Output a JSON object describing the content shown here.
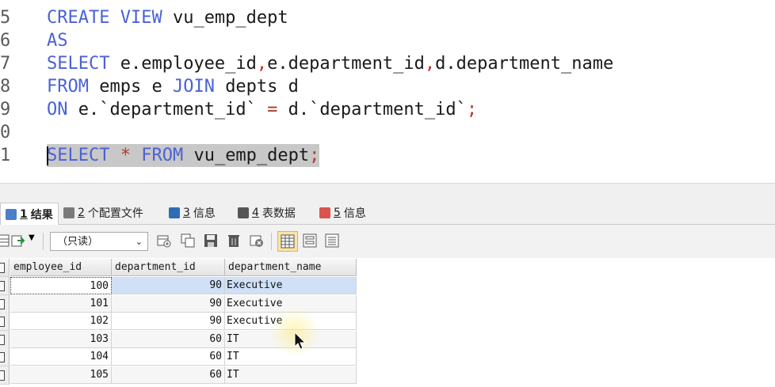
{
  "editor": {
    "lines": [
      {
        "num": "5",
        "tokens": [
          [
            "kw",
            "CREATE VIEW "
          ],
          [
            "txt",
            "vu_emp_dept"
          ]
        ]
      },
      {
        "num": "6",
        "tokens": [
          [
            "kw",
            "AS"
          ]
        ]
      },
      {
        "num": "7",
        "tokens": [
          [
            "kw",
            "SELECT "
          ],
          [
            "txt",
            "e.employee_id"
          ],
          [
            "op",
            ","
          ],
          [
            "txt",
            "e.department_id"
          ],
          [
            "op",
            ","
          ],
          [
            "txt",
            "d.department_name"
          ]
        ]
      },
      {
        "num": "8",
        "tokens": [
          [
            "kw",
            "FROM "
          ],
          [
            "txt",
            "emps e "
          ],
          [
            "kw",
            "JOIN "
          ],
          [
            "txt",
            "depts d"
          ]
        ]
      },
      {
        "num": "9",
        "tokens": [
          [
            "kw",
            "ON "
          ],
          [
            "txt",
            "e.`department_id` "
          ],
          [
            "op",
            "="
          ],
          [
            "txt",
            " d.`department_id`"
          ],
          [
            "op",
            ";"
          ]
        ]
      },
      {
        "num": "0",
        "tokens": []
      },
      {
        "num": "1",
        "tokens": [
          [
            "kw",
            "SELECT "
          ],
          [
            "op",
            "*"
          ],
          [
            "kw",
            " FROM "
          ],
          [
            "txt",
            "vu_emp_dept"
          ],
          [
            "op",
            ";"
          ]
        ],
        "highlighted": true
      }
    ]
  },
  "tabs": [
    {
      "num": "1",
      "label": "结果",
      "active": true,
      "icon": "table-icon",
      "color": "#4a7fc9"
    },
    {
      "num": "2",
      "label": "个配置文件",
      "icon": "profile-icon",
      "color": "#7a7a7a"
    },
    {
      "num": "3",
      "label": "信息",
      "icon": "info-icon",
      "color": "#2f6db3"
    },
    {
      "num": "4",
      "label": "表数据",
      "icon": "table-data-icon",
      "color": "#555555"
    },
    {
      "num": "5",
      "label": "信息",
      "icon": "history-icon",
      "color": "#d9534f"
    }
  ],
  "toolbar": {
    "mode_select": "（只读）"
  },
  "grid": {
    "columns": [
      "employee_id",
      "department_id",
      "department_name"
    ],
    "rows": [
      [
        "100",
        "90",
        "Executive"
      ],
      [
        "101",
        "90",
        "Executive"
      ],
      [
        "102",
        "90",
        "Executive"
      ],
      [
        "103",
        "60",
        "IT"
      ],
      [
        "104",
        "60",
        "IT"
      ],
      [
        "105",
        "60",
        "IT"
      ]
    ]
  },
  "colors": {
    "keyword": "#4a62d6",
    "operator": "#b23a2a",
    "selection": "#cfe0f7"
  }
}
